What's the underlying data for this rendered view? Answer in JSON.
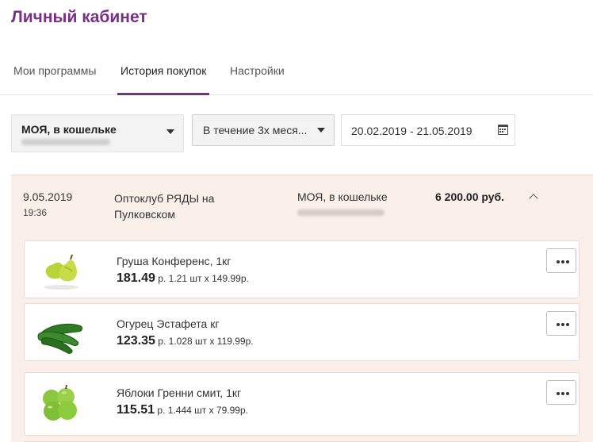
{
  "page": {
    "title": "Личный кабинет"
  },
  "tabs": [
    {
      "label": "Мои программы"
    },
    {
      "label": "История покупок"
    },
    {
      "label": "Настройки"
    }
  ],
  "filters": {
    "wallet": {
      "title": "МОЯ, в кошельке"
    },
    "period": {
      "value": "В течение 3х меся..."
    },
    "date_range": {
      "value": "20.02.2019 - 21.05.2019"
    }
  },
  "order": {
    "date": "9.05.2019",
    "time": "19:36",
    "store": "Оптоклуб РЯДЫ на Пулковском",
    "wallet": "МОЯ, в кошельке",
    "total": "6 200.00 руб."
  },
  "items": [
    {
      "name": "Груша Конференс, 1кг",
      "price": "181.49",
      "currency": "р.",
      "qty": "1.21 шт х 149.99р.",
      "icon": "pear-icon"
    },
    {
      "name": "Огурец Эстафета кг",
      "price": "123.35",
      "currency": "р.",
      "qty": "1.028 шт х 119.99р.",
      "icon": "cucumber-icon"
    },
    {
      "name": "Яблоки Гренни смит, 1кг",
      "price": "115.51",
      "currency": "р.",
      "qty": "1.444 шт х 79.99р.",
      "icon": "apple-icon"
    }
  ],
  "colors": {
    "brand": "#7a2f86",
    "panel_bg": "#fbf0e9"
  }
}
